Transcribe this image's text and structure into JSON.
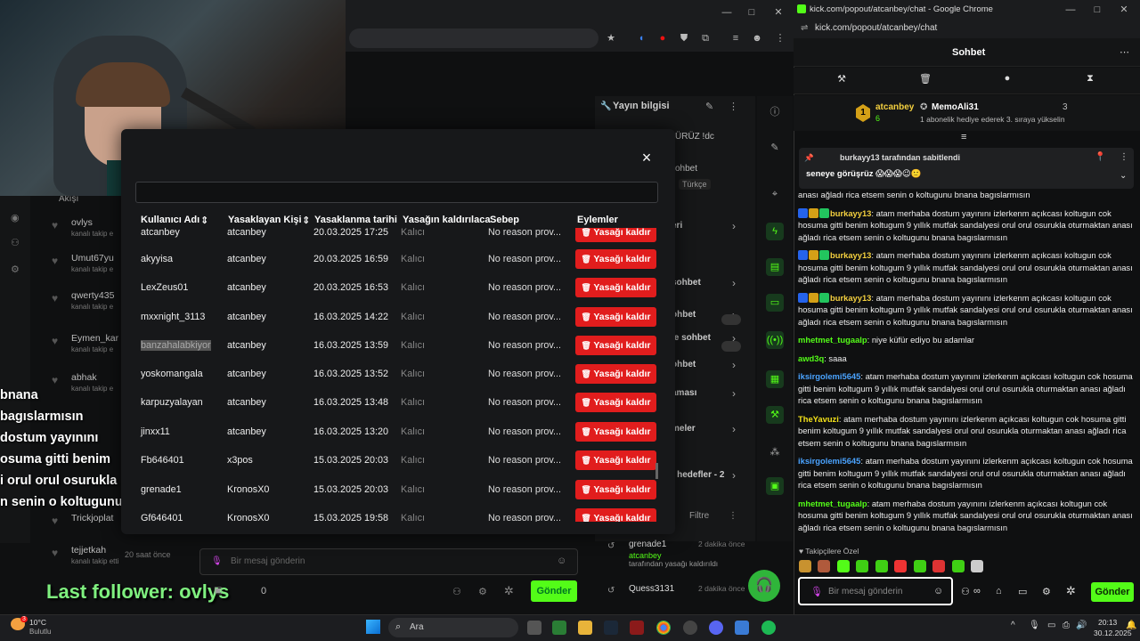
{
  "left_window": {
    "tabs_area": "",
    "followers_header": "Akışı",
    "followers": [
      {
        "name": "ovlys",
        "sub": "kanalı takip e"
      },
      {
        "name": "Umut67yu",
        "sub": "kanalı takip e"
      },
      {
        "name": "qwerty435",
        "sub": "kanalı takip e"
      },
      {
        "name": "Eymen_kar",
        "sub": "kanalı takip e"
      },
      {
        "name": "abhak",
        "sub": "kanalı takip e"
      },
      {
        "name": "Trickjoplat",
        "sub": ""
      },
      {
        "name": "tejjetkah",
        "sub": "kanalı takip etti"
      }
    ],
    "tejjetkah_time": "20 saat önce",
    "overlay_lines": [
      "bnana bagıslarmısın",
      "dostum yayınını",
      "osuma gitti benim",
      "i orul orul osurukla",
      "n senin o koltugunu"
    ],
    "last_follower": "Last follower: ovlys"
  },
  "dashboard": {
    "stream_info_title": "Yayın bilgisi",
    "stream_info_text": "ÜRÜZ !dc",
    "stream_info_lang_label": "ohbet",
    "stream_info_lang": "Türkçe",
    "side_labels": [
      "eri",
      "sohbet",
      "ohbet",
      "le sohbet",
      "ohbet",
      "aması",
      "meler",
      "f hedefler - 2"
    ],
    "filter_label": "Filtre",
    "chat_placeholder": "Bir mesaj gönderin",
    "viewer_count": "0",
    "send_label": "Gönder",
    "activity": [
      {
        "user": "grenade1",
        "time": "2 dakika önce",
        "by": "atcanbey",
        "text": "tarafından yasağı kaldırıldı"
      },
      {
        "user": "Quess3131",
        "time": "2 dakika önce",
        "by": "",
        "text": ""
      }
    ]
  },
  "modal": {
    "close_icon": "×",
    "columns": [
      "Kullanıcı Adı",
      "Yasaklayan Kişi",
      "Yasaklanma tarihi",
      "Yasağın kaldırılaca",
      "Sebep",
      "Eylemler"
    ],
    "rows": [
      {
        "user": "atcanbey",
        "by": "atcanbey",
        "date": "20.03.2025 17:25",
        "dur": "Kalıcı",
        "reason": "No reason prov...",
        "partial": true
      },
      {
        "user": "akyyisa",
        "by": "atcanbey",
        "date": "20.03.2025 16:59",
        "dur": "Kalıcı",
        "reason": "No reason prov..."
      },
      {
        "user": "LexZeus01",
        "by": "atcanbey",
        "date": "20.03.2025 16:53",
        "dur": "Kalıcı",
        "reason": "No reason prov..."
      },
      {
        "user": "mxxnight_3113",
        "by": "atcanbey",
        "date": "16.03.2025 14:22",
        "dur": "Kalıcı",
        "reason": "No reason prov..."
      },
      {
        "user": "banzahalabkiyor",
        "by": "atcanbey",
        "date": "16.03.2025 13:59",
        "dur": "Kalıcı",
        "reason": "No reason prov...",
        "selected": true
      },
      {
        "user": "yoskomangala",
        "by": "atcanbey",
        "date": "16.03.2025 13:52",
        "dur": "Kalıcı",
        "reason": "No reason prov..."
      },
      {
        "user": "karpuzyalayan",
        "by": "atcanbey",
        "date": "16.03.2025 13:48",
        "dur": "Kalıcı",
        "reason": "No reason prov..."
      },
      {
        "user": "jinxx11",
        "by": "atcanbey",
        "date": "16.03.2025 13:20",
        "dur": "Kalıcı",
        "reason": "No reason prov..."
      },
      {
        "user": "Fb646401",
        "by": "x3pos",
        "date": "15.03.2025 20:03",
        "dur": "Kalıcı",
        "reason": "No reason prov..."
      },
      {
        "user": "grenade1",
        "by": "KronosX0",
        "date": "15.03.2025 20:03",
        "dur": "Kalıcı",
        "reason": "No reason prov..."
      },
      {
        "user": "Gf646401",
        "by": "KronosX0",
        "date": "15.03.2025 19:58",
        "dur": "Kalıcı",
        "reason": "No reason prov...",
        "partial": true
      }
    ],
    "unban_label": "Yasağı kaldır"
  },
  "chat_window": {
    "title": "kick.com/popout/atcanbey/chat - Google Chrome",
    "url": "kick.com/popout/atcanbey/chat",
    "header": "Sohbet",
    "leader": {
      "rank": "1",
      "name": "atcanbey",
      "count": "6",
      "gifter": "MemoAli31",
      "gifter_count": "3",
      "note": "1 abonelik hediye ederek 3. sıraya yükselin"
    },
    "pinned_by": "burkayy13 tarafından sabitlendi",
    "pinned_text": "seneye görüşrüz 😱😱😱😉🙂",
    "messages": [
      {
        "user": "",
        "color": "#eee",
        "text": "anası ağladı rica etsem senin o koltugunu bnana bagıslarmısın"
      },
      {
        "user": "burkayy13",
        "color": "#f4d03f",
        "text": "atam merhaba dostum yayınını izlerkenm açıkcası koltugun cok hosuma gitti benim koltugum 9 yıllık mutfak sandalyesi orul orul osurukla oturmaktan anası ağladı rica etsem senin o koltugunu bnana bagıslarmısın"
      },
      {
        "user": "burkayy13",
        "color": "#f4d03f",
        "text": "atam merhaba dostum yayınını izlerkenm açıkcası koltugun cok hosuma gitti benim koltugum 9 yıllık mutfak sandalyesi orul orul osurukla oturmaktan anası ağladı rica etsem senin o koltugunu bnana bagıslarmısın"
      },
      {
        "user": "burkayy13",
        "color": "#f4d03f",
        "text": "atam merhaba dostum yayınını izlerkenm açıkcası koltugun cok hosuma gitti benim koltugum 9 yıllık mutfak sandalyesi orul orul osurukla oturmaktan anası ağladı rica etsem senin o koltugunu bnana bagıslarmısın"
      },
      {
        "user": "mhetmet_tugaalp",
        "color": "#53fc18",
        "text": "niye küfür ediyo bu adamlar"
      },
      {
        "user": "awd3q",
        "color": "#53fc18",
        "text": "saaa"
      },
      {
        "user": "iksirgolemi5645",
        "color": "#4aa3ff",
        "text": "atam merhaba dostum yayınını izlerkenm açıkcası koltugun cok hosuma gitti benim koltugum 9 yıllık mutfak sandalyesi orul orul osurukla oturmaktan anası ağladı rica etsem senin o koltugunu bnana bagıslarmısın"
      },
      {
        "user": "TheYavuzi",
        "color": "#f4e21a",
        "text": "atam merhaba dostum yayınını izlerkenm açıkcası koltugun cok hosuma gitti benim koltugum 9 yıllık mutfak sandalyesi orul orul osurukla oturmaktan anası ağladı rica etsem senin o koltugunu bnana bagıslarmısın"
      },
      {
        "user": "iksirgolemi5645",
        "color": "#4aa3ff",
        "text": "atam merhaba dostum yayınını izlerkenm açıkcası koltugun cok hosuma gitti benim koltugum 9 yıllık mutfak sandalyesi orul orul osurukla oturmaktan anası ağladı rica etsem senin o koltugunu bnana bagıslarmısın"
      },
      {
        "user": "mhetmet_tugaalp",
        "color": "#53fc18",
        "text": "atam merhaba dostum yayınını izlerkenm açıkcası koltugun cok hosuma gitti benim koltugum 9 yıllık mutfak sandalyesi orul orul osurukla oturmaktan anası ağladı rica etsem senin o koltugunu bnana bagıslarmısın"
      }
    ],
    "followers_only": "Takipçilere Özel",
    "input_placeholder": "Bir mesaj gönderin",
    "send_label": "Gönder"
  },
  "taskbar": {
    "weather_temp": "10°C",
    "weather_desc": "Bulutlu",
    "weather_badge": "3",
    "search_label": "Ara",
    "time": "20:13",
    "date": "30.12.2025"
  },
  "colors": {
    "accent": "#53fc18",
    "danger": "#e11d1d",
    "chrome": "#1b1c1e"
  }
}
